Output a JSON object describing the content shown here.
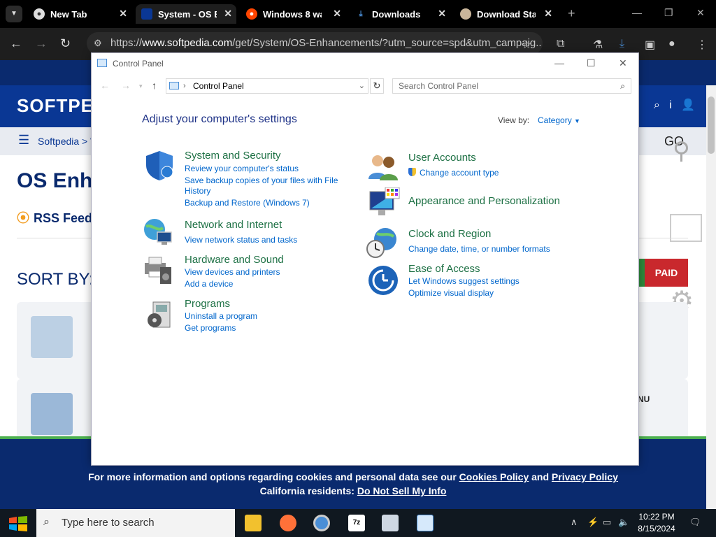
{
  "browser": {
    "tabs": [
      {
        "title": "New Tab",
        "icon": "chrome-icon"
      },
      {
        "title": "System - OS En",
        "icon": "softpedia-favicon"
      },
      {
        "title": "Windows 8 wa",
        "icon": "reddit-icon"
      },
      {
        "title": "Downloads",
        "icon": "download-icon"
      },
      {
        "title": "Download Star",
        "icon": "softpedia-favicon"
      }
    ],
    "url_host": "www.softpedia.com",
    "url_prefix": "https://",
    "url_path": "/get/System/OS-Enhancements/?utm_source=spd&utm_campaig..."
  },
  "site": {
    "logo": "SOFTPE",
    "breadcrumb": "Softpedia > W",
    "go": "GO",
    "title": "OS Enhan",
    "rss": "RSS Feed",
    "sort_by": "SORT BY:",
    "paid": "PAID",
    "nu": "NU",
    "cookie": {
      "prefix": "For more information and options regarding cookies and personal data see our",
      "cookies_link": "Cookies Policy",
      "and": "and",
      "privacy_link": "Privacy Policy",
      "ca_prefix": "California residents:",
      "ca_link": "Do Not Sell My Info"
    }
  },
  "control_panel": {
    "window_title": "Control Panel",
    "address": "Control Panel",
    "search_placeholder": "Search Control Panel",
    "heading": "Adjust your computer's settings",
    "view_by_label": "View by:",
    "view_by_value": "Category",
    "left": [
      {
        "title": "System and Security",
        "icon": "shield-icon",
        "links": [
          "Review your computer's status",
          "Save backup copies of your files with File",
          "History",
          "Backup and Restore (Windows 7)"
        ]
      },
      {
        "title": "Network and Internet",
        "icon": "globe-network-icon",
        "links": [
          "View network status and tasks"
        ]
      },
      {
        "title": "Hardware and Sound",
        "icon": "printer-speaker-icon",
        "links": [
          "View devices and printers",
          "Add a device"
        ]
      },
      {
        "title": "Programs",
        "icon": "programs-icon",
        "links": [
          "Uninstall a program",
          "Get programs"
        ]
      }
    ],
    "right": [
      {
        "title": "User Accounts",
        "icon": "users-icon",
        "links": [
          "Change account type"
        ]
      },
      {
        "title": "Appearance and Personalization",
        "icon": "monitor-palette-icon",
        "links": []
      },
      {
        "title": "Clock and Region",
        "icon": "clock-globe-icon",
        "links": [
          "Change date, time, or number formats"
        ]
      },
      {
        "title": "Ease of Access",
        "icon": "ease-of-access-icon",
        "links": [
          "Let Windows suggest settings",
          "Optimize visual display"
        ]
      }
    ]
  },
  "taskbar": {
    "search_placeholder": "Type here to search",
    "time": "10:22 PM",
    "date": "8/15/2024"
  },
  "colors": {
    "accent": "#0a3794",
    "cp_link": "#0066cc",
    "cp_title": "#1e7145"
  }
}
